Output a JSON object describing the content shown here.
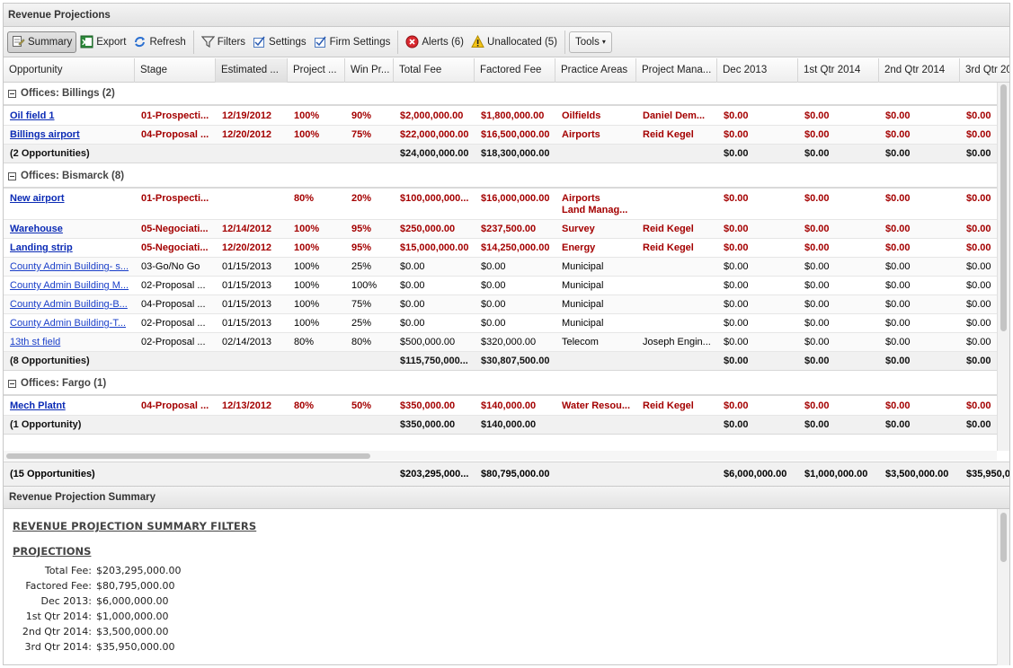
{
  "window": {
    "title": "Revenue Projections"
  },
  "toolbar": {
    "summary": "Summary",
    "export": "Export",
    "refresh": "Refresh",
    "filters": "Filters",
    "settings": "Settings",
    "firm_settings": "Firm Settings",
    "alerts": "Alerts (6)",
    "unallocated": "Unallocated (5)",
    "tools": "Tools"
  },
  "columns": [
    "Opportunity",
    "Stage",
    "Estimated ...",
    "Project ...",
    "Win Pr...",
    "Total Fee",
    "Factored Fee",
    "Practice Areas",
    "Project Mana...",
    "Dec 2013",
    "1st Qtr 2014",
    "2nd Qtr 2014",
    "3rd Qtr 20"
  ],
  "groups": [
    {
      "label": "Offices: Billings (2)",
      "rows": [
        {
          "style": "red",
          "cells": [
            "Oil field 1",
            "01-Prospecti...",
            "12/19/2012",
            "100%",
            "90%",
            "$2,000,000.00",
            "$1,800,000.00",
            "Oilfields",
            "Daniel Dem...",
            "$0.00",
            "$0.00",
            "$0.00",
            "$0.00"
          ]
        },
        {
          "style": "red",
          "cells": [
            "Billings airport",
            "04-Proposal ...",
            "12/20/2012",
            "100%",
            "75%",
            "$22,000,000.00",
            "$16,500,000.00",
            "Airports",
            "Reid Kegel",
            "$0.00",
            "$0.00",
            "$0.00",
            "$0.00"
          ]
        }
      ],
      "summary": [
        "(2 Opportunities)",
        "",
        "",
        "",
        "",
        "$24,000,000.00",
        "$18,300,000.00",
        "",
        "",
        "$0.00",
        "$0.00",
        "$0.00",
        "$0.00"
      ]
    },
    {
      "label": "Offices: Bismarck (8)",
      "rows": [
        {
          "style": "red",
          "tall": true,
          "cells": [
            "New airport",
            "01-Prospecti...",
            "",
            "80%",
            "20%",
            "$100,000,000...",
            "$16,000,000.00",
            "Airports",
            "",
            "$0.00",
            "$0.00",
            "$0.00",
            "$0.00"
          ],
          "extra": "Land Manag..."
        },
        {
          "style": "red",
          "cells": [
            "Warehouse",
            "05-Negociati...",
            "12/14/2012",
            "100%",
            "95%",
            "$250,000.00",
            "$237,500.00",
            "Survey",
            "Reid Kegel",
            "$0.00",
            "$0.00",
            "$0.00",
            "$0.00"
          ]
        },
        {
          "style": "red",
          "cells": [
            "Landing strip",
            "05-Negociati...",
            "12/20/2012",
            "100%",
            "95%",
            "$15,000,000.00",
            "$14,250,000.00",
            "Energy",
            "Reid Kegel",
            "$0.00",
            "$0.00",
            "$0.00",
            "$0.00"
          ]
        },
        {
          "style": "normal",
          "cells": [
            "County Admin Building- s...",
            "03-Go/No Go",
            "01/15/2013",
            "100%",
            "25%",
            "$0.00",
            "$0.00",
            "Municipal",
            "",
            "$0.00",
            "$0.00",
            "$0.00",
            "$0.00"
          ]
        },
        {
          "style": "normal",
          "cells": [
            "County Admin Building M...",
            "02-Proposal ...",
            "01/15/2013",
            "100%",
            "100%",
            "$0.00",
            "$0.00",
            "Municipal",
            "",
            "$0.00",
            "$0.00",
            "$0.00",
            "$0.00"
          ]
        },
        {
          "style": "normal",
          "cells": [
            "County Admin Building-B...",
            "04-Proposal ...",
            "01/15/2013",
            "100%",
            "75%",
            "$0.00",
            "$0.00",
            "Municipal",
            "",
            "$0.00",
            "$0.00",
            "$0.00",
            "$0.00"
          ]
        },
        {
          "style": "normal",
          "cells": [
            "County Admin Building-T...",
            "02-Proposal ...",
            "01/15/2013",
            "100%",
            "25%",
            "$0.00",
            "$0.00",
            "Municipal",
            "",
            "$0.00",
            "$0.00",
            "$0.00",
            "$0.00"
          ]
        },
        {
          "style": "normal",
          "cells": [
            "13th st field",
            "02-Proposal ...",
            "02/14/2013",
            "80%",
            "80%",
            "$500,000.00",
            "$320,000.00",
            "Telecom",
            "Joseph Engin...",
            "$0.00",
            "$0.00",
            "$0.00",
            "$0.00"
          ]
        }
      ],
      "summary": [
        "(8 Opportunities)",
        "",
        "",
        "",
        "",
        "$115,750,000...",
        "$30,807,500.00",
        "",
        "",
        "$0.00",
        "$0.00",
        "$0.00",
        "$0.00"
      ]
    },
    {
      "label": "Offices: Fargo (1)",
      "rows": [
        {
          "style": "red",
          "cells": [
            "Mech Platnt",
            "04-Proposal ...",
            "12/13/2012",
            "80%",
            "50%",
            "$350,000.00",
            "$140,000.00",
            "Water Resou...",
            "Reid Kegel",
            "$0.00",
            "$0.00",
            "$0.00",
            "$0.00"
          ]
        }
      ],
      "summary": [
        "(1 Opportunity)",
        "",
        "",
        "",
        "",
        "$350,000.00",
        "$140,000.00",
        "",
        "",
        "$0.00",
        "$0.00",
        "$0.00",
        "$0.00"
      ]
    }
  ],
  "grand_total": [
    "(15 Opportunities)",
    "",
    "",
    "",
    "",
    "$203,295,000...",
    "$80,795,000.00",
    "",
    "",
    "$6,000,000.00",
    "$1,000,000.00",
    "$3,500,000.00",
    "$35,950,0("
  ],
  "summary_panel": {
    "title": "Revenue Projection Summary",
    "filters_heading": "REVENUE PROJECTION SUMMARY FILTERS",
    "projections_heading": "PROJECTIONS",
    "items": [
      {
        "label": "Total Fee:",
        "value": "$203,295,000.00"
      },
      {
        "label": "Factored Fee:",
        "value": "$80,795,000.00"
      },
      {
        "label": "Dec 2013:",
        "value": "$6,000,000.00"
      },
      {
        "label": "1st Qtr 2014:",
        "value": "$1,000,000.00"
      },
      {
        "label": "2nd Qtr 2014:",
        "value": "$3,500,000.00"
      },
      {
        "label": "3rd Qtr 2014:",
        "value": "$35,950,000.00"
      }
    ]
  }
}
